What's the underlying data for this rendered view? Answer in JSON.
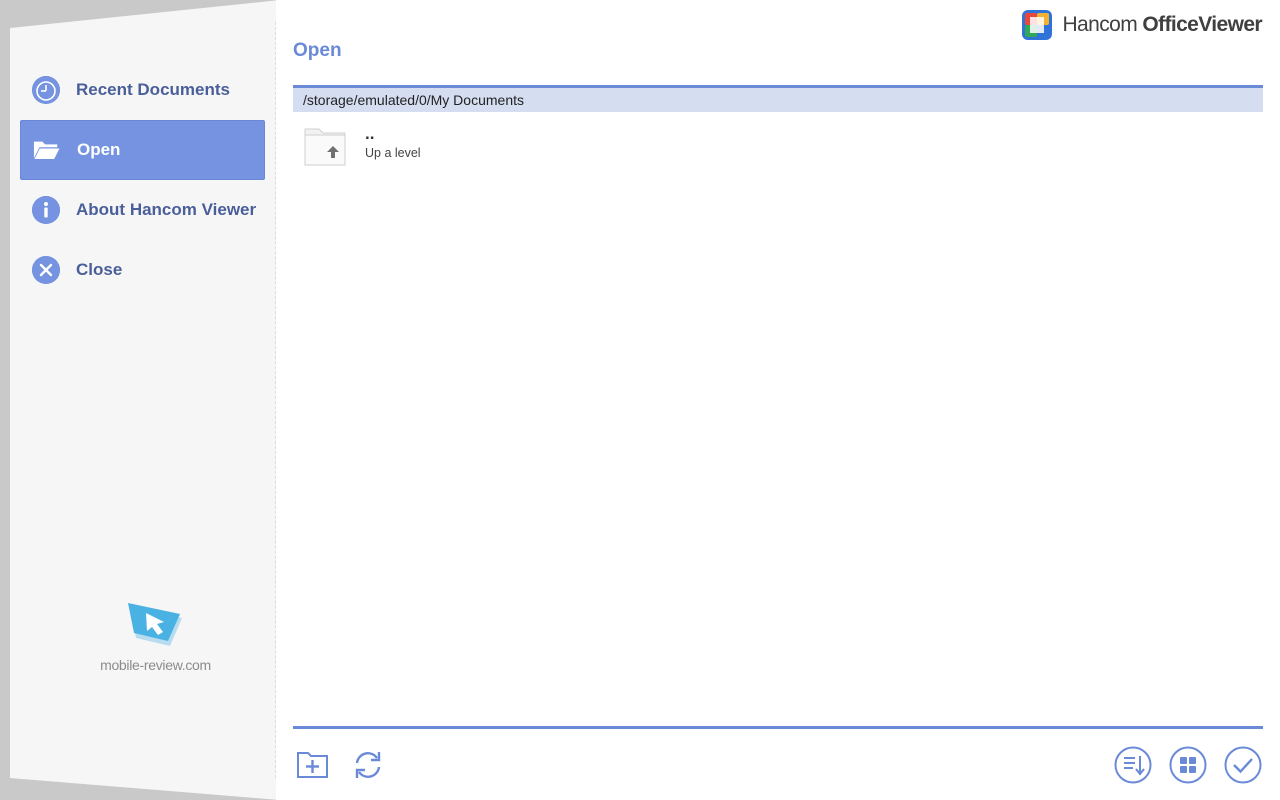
{
  "sidebar": {
    "items": [
      {
        "label": "Recent Documents",
        "icon": "clock-icon"
      },
      {
        "label": "Open",
        "icon": "open-folder-icon",
        "active": true
      },
      {
        "label": "About Hancom Viewer",
        "icon": "info-icon"
      },
      {
        "label": "Close",
        "icon": "close-icon"
      }
    ],
    "watermark": "mobile-review.com"
  },
  "header": {
    "title": "Open",
    "brand_light": "Hancom",
    "brand_bold": "OfficeViewer"
  },
  "path": "/storage/emulated/0/My Documents",
  "files": [
    {
      "name": "..",
      "subtitle": "Up a level",
      "icon": "folder-up-icon"
    }
  ],
  "toolbar": {
    "left": [
      "new-folder-icon",
      "refresh-icon"
    ],
    "right": [
      "sort-icon",
      "grid-view-icon",
      "confirm-check-icon"
    ]
  },
  "colors": {
    "accent": "#7593e0",
    "accent_dark": "#4a5f9a",
    "path_bg": "#d5ddf1"
  }
}
